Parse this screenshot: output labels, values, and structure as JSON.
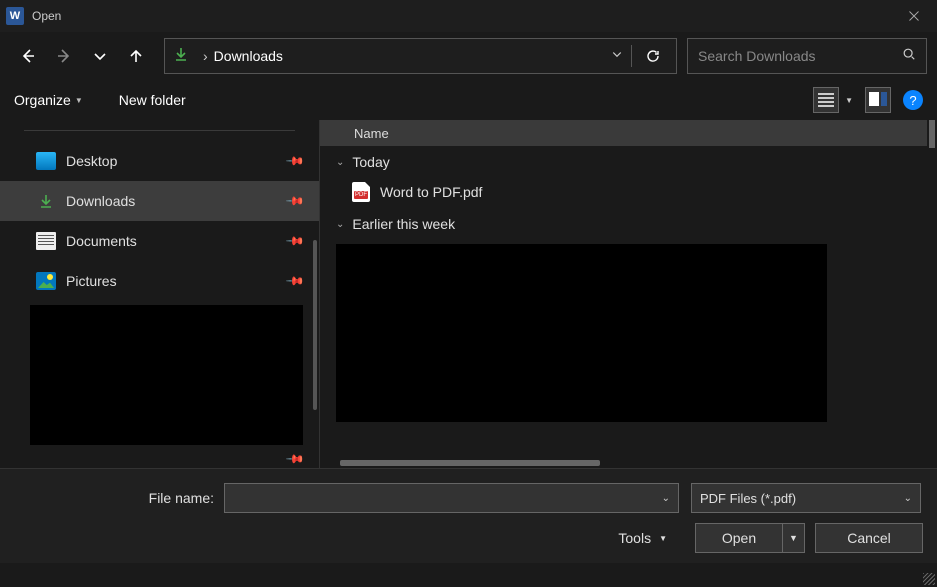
{
  "window": {
    "title": "Open",
    "app_letter": "W"
  },
  "nav": {
    "current_path": "Downloads",
    "search_placeholder": "Search Downloads"
  },
  "toolbar": {
    "organize": "Organize",
    "new_folder": "New folder"
  },
  "sidebar": {
    "items": [
      {
        "label": "Desktop",
        "icon": "desktop",
        "selected": false
      },
      {
        "label": "Downloads",
        "icon": "dl",
        "selected": true
      },
      {
        "label": "Documents",
        "icon": "docs",
        "selected": false
      },
      {
        "label": "Pictures",
        "icon": "pics",
        "selected": false
      }
    ]
  },
  "content": {
    "column_header": "Name",
    "groups": [
      {
        "label": "Today",
        "files": [
          {
            "name": "Word to PDF.pdf"
          }
        ]
      },
      {
        "label": "Earlier this week",
        "files": []
      }
    ]
  },
  "footer": {
    "filename_label": "File name:",
    "filename_value": "",
    "filetype_value": "PDF Files (*.pdf)",
    "tools_label": "Tools",
    "open_label": "Open",
    "cancel_label": "Cancel"
  }
}
